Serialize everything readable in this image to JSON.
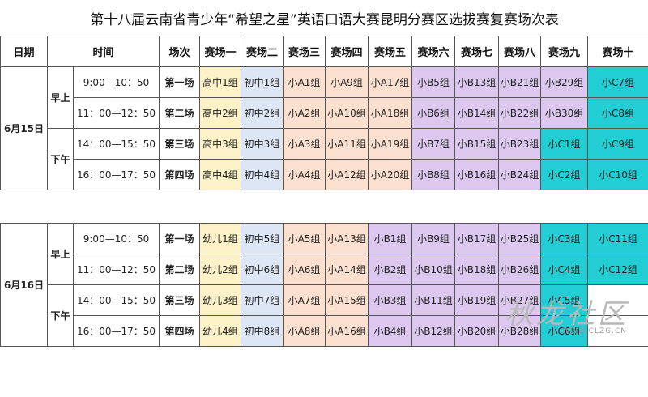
{
  "title": "第十八届云南省青少年“希望之星”英语口语大赛昆明分赛区选拔赛复赛场次表",
  "headers": {
    "date": "日期",
    "time": "时间",
    "session": "场次",
    "venues": [
      "赛场一",
      "赛场二",
      "赛场三",
      "赛场四",
      "赛场五",
      "赛场六",
      "赛场七",
      "赛场八",
      "赛场九",
      "赛场十"
    ]
  },
  "days": [
    {
      "date": "6月15日",
      "periods": [
        {
          "label": "早上",
          "rows": [
            {
              "time": "9:00—10：50",
              "session": "第一场",
              "cells": [
                {
                  "text": "高中1组",
                  "color": "y"
                },
                {
                  "text": "初中1组",
                  "color": "b"
                },
                {
                  "text": "小A1组",
                  "color": "o"
                },
                {
                  "text": "小A9组",
                  "color": "o"
                },
                {
                  "text": "小A17组",
                  "color": "o"
                },
                {
                  "text": "小B5组",
                  "color": "p"
                },
                {
                  "text": "小B13组",
                  "color": "p"
                },
                {
                  "text": "小B21组",
                  "color": "p"
                },
                {
                  "text": "小B29组",
                  "color": "p"
                },
                {
                  "text": "小C7组",
                  "color": "t"
                }
              ]
            },
            {
              "time": "11：00—12：50",
              "session": "第二场",
              "cells": [
                {
                  "text": "高中2组",
                  "color": "y"
                },
                {
                  "text": "初中2组",
                  "color": "b"
                },
                {
                  "text": "小A2组",
                  "color": "o"
                },
                {
                  "text": "小A10组",
                  "color": "o"
                },
                {
                  "text": "小A18组",
                  "color": "o"
                },
                {
                  "text": "小B6组",
                  "color": "p"
                },
                {
                  "text": "小B14组",
                  "color": "p"
                },
                {
                  "text": "小B22组",
                  "color": "p"
                },
                {
                  "text": "小B30组",
                  "color": "p"
                },
                {
                  "text": "小C8组",
                  "color": "t"
                }
              ]
            }
          ]
        },
        {
          "label": "下午",
          "rows": [
            {
              "time": "14：00—15：50",
              "session": "第三场",
              "cells": [
                {
                  "text": "高中3组",
                  "color": "y"
                },
                {
                  "text": "初中3组",
                  "color": "b"
                },
                {
                  "text": "小A3组",
                  "color": "o"
                },
                {
                  "text": "小A11组",
                  "color": "o"
                },
                {
                  "text": "小A19组",
                  "color": "o"
                },
                {
                  "text": "小B7组",
                  "color": "p"
                },
                {
                  "text": "小B15组",
                  "color": "p"
                },
                {
                  "text": "小B23组",
                  "color": "p"
                },
                {
                  "text": "小C1组",
                  "color": "t"
                },
                {
                  "text": "小C9组",
                  "color": "t"
                }
              ]
            },
            {
              "time": "16：00—17：50",
              "session": "第四场",
              "cells": [
                {
                  "text": "高中4组",
                  "color": "y"
                },
                {
                  "text": "初中4组",
                  "color": "b"
                },
                {
                  "text": "小A4组",
                  "color": "o"
                },
                {
                  "text": "小A12组",
                  "color": "o"
                },
                {
                  "text": "小A20组",
                  "color": "o"
                },
                {
                  "text": "小B8组",
                  "color": "p"
                },
                {
                  "text": "小B16组",
                  "color": "p"
                },
                {
                  "text": "小B24组",
                  "color": "p"
                },
                {
                  "text": "小C2组",
                  "color": "t"
                },
                {
                  "text": "小C10组",
                  "color": "t"
                }
              ]
            }
          ]
        }
      ]
    },
    {
      "date": "6月16日",
      "periods": [
        {
          "label": "早上",
          "rows": [
            {
              "time": "9:00—10：50",
              "session": "第一场",
              "cells": [
                {
                  "text": "幼儿1组",
                  "color": "y"
                },
                {
                  "text": "初中5组",
                  "color": "b"
                },
                {
                  "text": "小A5组",
                  "color": "o"
                },
                {
                  "text": "小A13组",
                  "color": "o"
                },
                {
                  "text": "小B1组",
                  "color": "p"
                },
                {
                  "text": "小B9组",
                  "color": "p"
                },
                {
                  "text": "小B17组",
                  "color": "p"
                },
                {
                  "text": "小B25组",
                  "color": "p"
                },
                {
                  "text": "小C3组",
                  "color": "t"
                },
                {
                  "text": "小C11组",
                  "color": "t"
                }
              ]
            },
            {
              "time": "11：00—12：50",
              "session": "第二场",
              "cells": [
                {
                  "text": "幼儿2组",
                  "color": "y"
                },
                {
                  "text": "初中6组",
                  "color": "b"
                },
                {
                  "text": "小A6组",
                  "color": "o"
                },
                {
                  "text": "小A14组",
                  "color": "o"
                },
                {
                  "text": "小B2组",
                  "color": "p"
                },
                {
                  "text": "小B10组",
                  "color": "p"
                },
                {
                  "text": "小B18组",
                  "color": "p"
                },
                {
                  "text": "小B26组",
                  "color": "p"
                },
                {
                  "text": "小C4组",
                  "color": "t"
                },
                {
                  "text": "小C12组",
                  "color": "t"
                }
              ]
            }
          ]
        },
        {
          "label": "下午",
          "rows": [
            {
              "time": "14：00—15：50",
              "session": "第三场",
              "cells": [
                {
                  "text": "幼儿3组",
                  "color": "y"
                },
                {
                  "text": "初中7组",
                  "color": "b"
                },
                {
                  "text": "小A7组",
                  "color": "o"
                },
                {
                  "text": "小A15组",
                  "color": "o"
                },
                {
                  "text": "小B3组",
                  "color": "p"
                },
                {
                  "text": "小B11组",
                  "color": "p"
                },
                {
                  "text": "小B19组",
                  "color": "p"
                },
                {
                  "text": "小B27组",
                  "color": "p"
                },
                {
                  "text": "小C5组",
                  "color": "t"
                },
                {
                  "text": "",
                  "color": "w"
                }
              ]
            },
            {
              "time": "16：00—17：50",
              "session": "第四场",
              "cells": [
                {
                  "text": "幼儿4组",
                  "color": "y"
                },
                {
                  "text": "初中8组",
                  "color": "b"
                },
                {
                  "text": "小A8组",
                  "color": "o"
                },
                {
                  "text": "小A16组",
                  "color": "o"
                },
                {
                  "text": "小B4组",
                  "color": "p"
                },
                {
                  "text": "小B12组",
                  "color": "p"
                },
                {
                  "text": "小B20组",
                  "color": "p"
                },
                {
                  "text": "小B28组",
                  "color": "p"
                },
                {
                  "text": "小C6组",
                  "color": "t"
                },
                {
                  "text": "",
                  "color": "w"
                }
              ]
            }
          ]
        }
      ]
    }
  ],
  "watermark": {
    "text": "秋龙社区",
    "url": "WWW.CLZG.CN"
  }
}
